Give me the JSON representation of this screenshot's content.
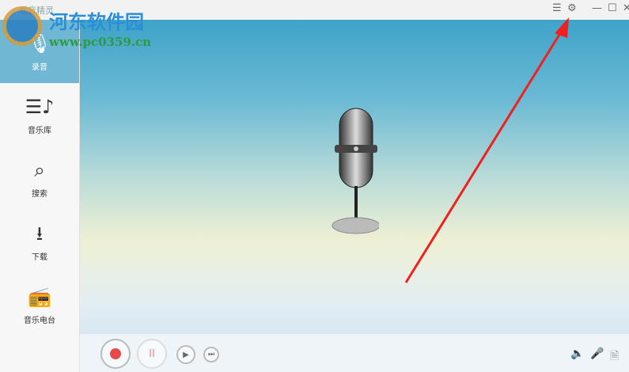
{
  "app": {
    "title": "爱音精灵"
  },
  "titlebar": {
    "list_icon": "☰",
    "settings_icon": "⚙",
    "minimize": "—",
    "maximize": "☐",
    "close": "✕"
  },
  "sidebar": {
    "items": [
      {
        "label": "录音",
        "icon": "🎙"
      },
      {
        "label": "音乐库",
        "icon": "☰♪"
      },
      {
        "label": "搜索",
        "icon": "⌕"
      },
      {
        "label": "下载",
        "icon": "⭳"
      },
      {
        "label": "音乐电台",
        "icon": "📻"
      }
    ]
  },
  "watermark": {
    "name": "河东软件园",
    "url": "www.pc0359.cn"
  },
  "controls": {
    "pause": "II",
    "play": "▶",
    "next": "⏭",
    "volume": "🔈",
    "mic": "🎤",
    "export": "🗎"
  }
}
